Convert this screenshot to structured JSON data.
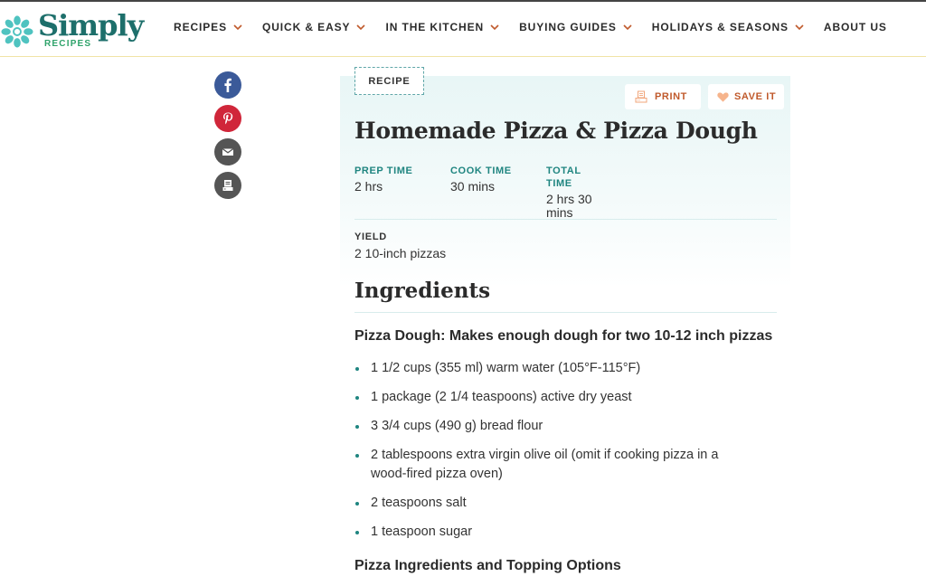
{
  "header": {
    "logo": {
      "word": "Simply",
      "sub": "RECIPES",
      "icon": "flower-logo-icon"
    },
    "nav": [
      {
        "label": "RECIPES",
        "has_dropdown": true
      },
      {
        "label": "QUICK & EASY",
        "has_dropdown": true
      },
      {
        "label": "IN THE KITCHEN",
        "has_dropdown": true
      },
      {
        "label": "BUYING GUIDES",
        "has_dropdown": true
      },
      {
        "label": "HOLIDAYS & SEASONS",
        "has_dropdown": true
      },
      {
        "label": "ABOUT US",
        "has_dropdown": false
      }
    ]
  },
  "social": [
    {
      "name": "facebook",
      "icon": "facebook-icon",
      "color": "#3b5a99"
    },
    {
      "name": "pinterest",
      "icon": "pinterest-icon",
      "color": "#d0263a"
    },
    {
      "name": "email",
      "icon": "email-icon",
      "color": "#555555"
    },
    {
      "name": "print",
      "icon": "print-icon",
      "color": "#555555"
    }
  ],
  "recipe": {
    "tag": "RECIPE",
    "actions": {
      "print": "PRINT",
      "save": "SAVE IT"
    },
    "title": "Homemade Pizza & Pizza Dough",
    "times": [
      {
        "label": "PREP TIME",
        "value": "2 hrs"
      },
      {
        "label": "COOK TIME",
        "value": "30 mins"
      },
      {
        "label": "TOTAL TIME",
        "value": "2 hrs 30 mins"
      }
    ],
    "yield": {
      "label": "YIELD",
      "value": "2 10-inch pizzas"
    }
  },
  "ingredients": {
    "title": "Ingredients",
    "sections": [
      {
        "heading": "Pizza Dough: Makes enough dough for two 10-12 inch pizzas",
        "items": [
          "1 1/2 cups (355 ml) warm water (105°F-115°F)",
          "1 package (2 1/4 teaspoons) active dry yeast",
          "3 3/4 cups (490 g) bread flour",
          "2 tablespoons extra virgin olive oil (omit if cooking pizza in a wood-fired pizza oven)",
          "2 teaspoons salt",
          "1 teaspoon sugar"
        ]
      },
      {
        "heading": "Pizza Ingredients and Topping Options",
        "items": []
      }
    ]
  },
  "colors": {
    "brand_teal": "#1d6f6b",
    "accent_teal": "#1f8580",
    "accent_orange": "#c05a2c",
    "logo_flower": "#4fc3c0",
    "logo_sub": "#2fa36b"
  }
}
